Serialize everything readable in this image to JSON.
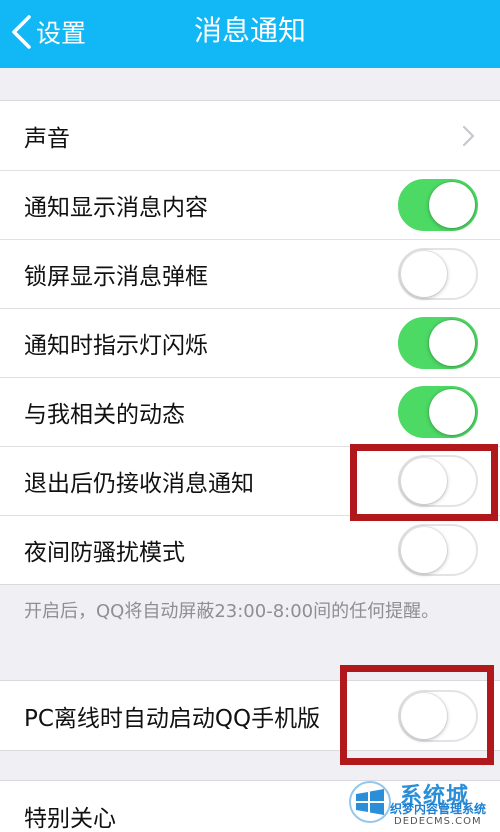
{
  "navbar": {
    "back_label": "设置",
    "title": "消息通知"
  },
  "group1": {
    "rows": [
      {
        "label": "声音",
        "control": "chevron"
      },
      {
        "label": "通知显示消息内容",
        "control": "switch",
        "on": true
      },
      {
        "label": "锁屏显示消息弹框",
        "control": "switch",
        "on": false
      },
      {
        "label": "通知时指示灯闪烁",
        "control": "switch",
        "on": true
      },
      {
        "label": "与我相关的动态",
        "control": "switch",
        "on": true
      },
      {
        "label": "退出后仍接收消息通知",
        "control": "switch",
        "on": false
      },
      {
        "label": "夜间防骚扰模式",
        "control": "switch",
        "on": false
      }
    ]
  },
  "night_mode_note": "开启后，QQ将自动屏蔽23:00-8:00间的任何提醒。",
  "group2": {
    "rows": [
      {
        "label": "PC离线时自动启动QQ手机版",
        "control": "switch",
        "on": false
      }
    ]
  },
  "group3": {
    "rows": [
      {
        "label": "特别关心",
        "control": "none"
      }
    ]
  },
  "watermark": {
    "brand": "系统城",
    "subtitle": "织梦内容管理系统",
    "domain": "DEDECMS.COM"
  },
  "colors": {
    "navbar": "#12b7f5",
    "switch_on": "#4cd964",
    "highlight": "#b0181b",
    "background": "#efeff4"
  }
}
